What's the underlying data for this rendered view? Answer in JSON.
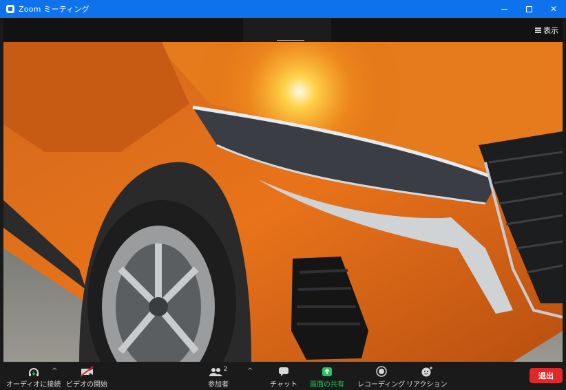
{
  "window": {
    "title": "Zoom ミーティング"
  },
  "top_bar": {
    "view_label": "表示"
  },
  "toolbar": {
    "audio_label": "オーディオに接続",
    "video_label": "ビデオの開始",
    "participants_label": "参加者",
    "participants_count": "2",
    "chat_label": "チャット",
    "share_label": "画面の共有",
    "record_label": "レコーディング",
    "reactions_label": "リアクション",
    "leave_label": "退出"
  },
  "colors": {
    "title_bar": "#0e72ed",
    "share_green": "#22c55e",
    "leave_red": "#e02828",
    "toolbar_bg": "#1a1a1a",
    "car_orange": "#e06a12"
  },
  "icons": {
    "app": "zoom-app-icon",
    "minimize": "minimize-icon",
    "maximize": "maximize-icon",
    "close": "close-icon",
    "view": "grid-view-icon",
    "audio": "headphones-icon",
    "video": "video-off-icon",
    "participants": "participants-icon",
    "chat": "chat-icon",
    "share": "share-screen-icon",
    "record": "record-icon",
    "reactions": "reaction-icon",
    "caret": "caret-up-icon"
  },
  "video_feed": {
    "description_alt": "orange car shared video"
  }
}
